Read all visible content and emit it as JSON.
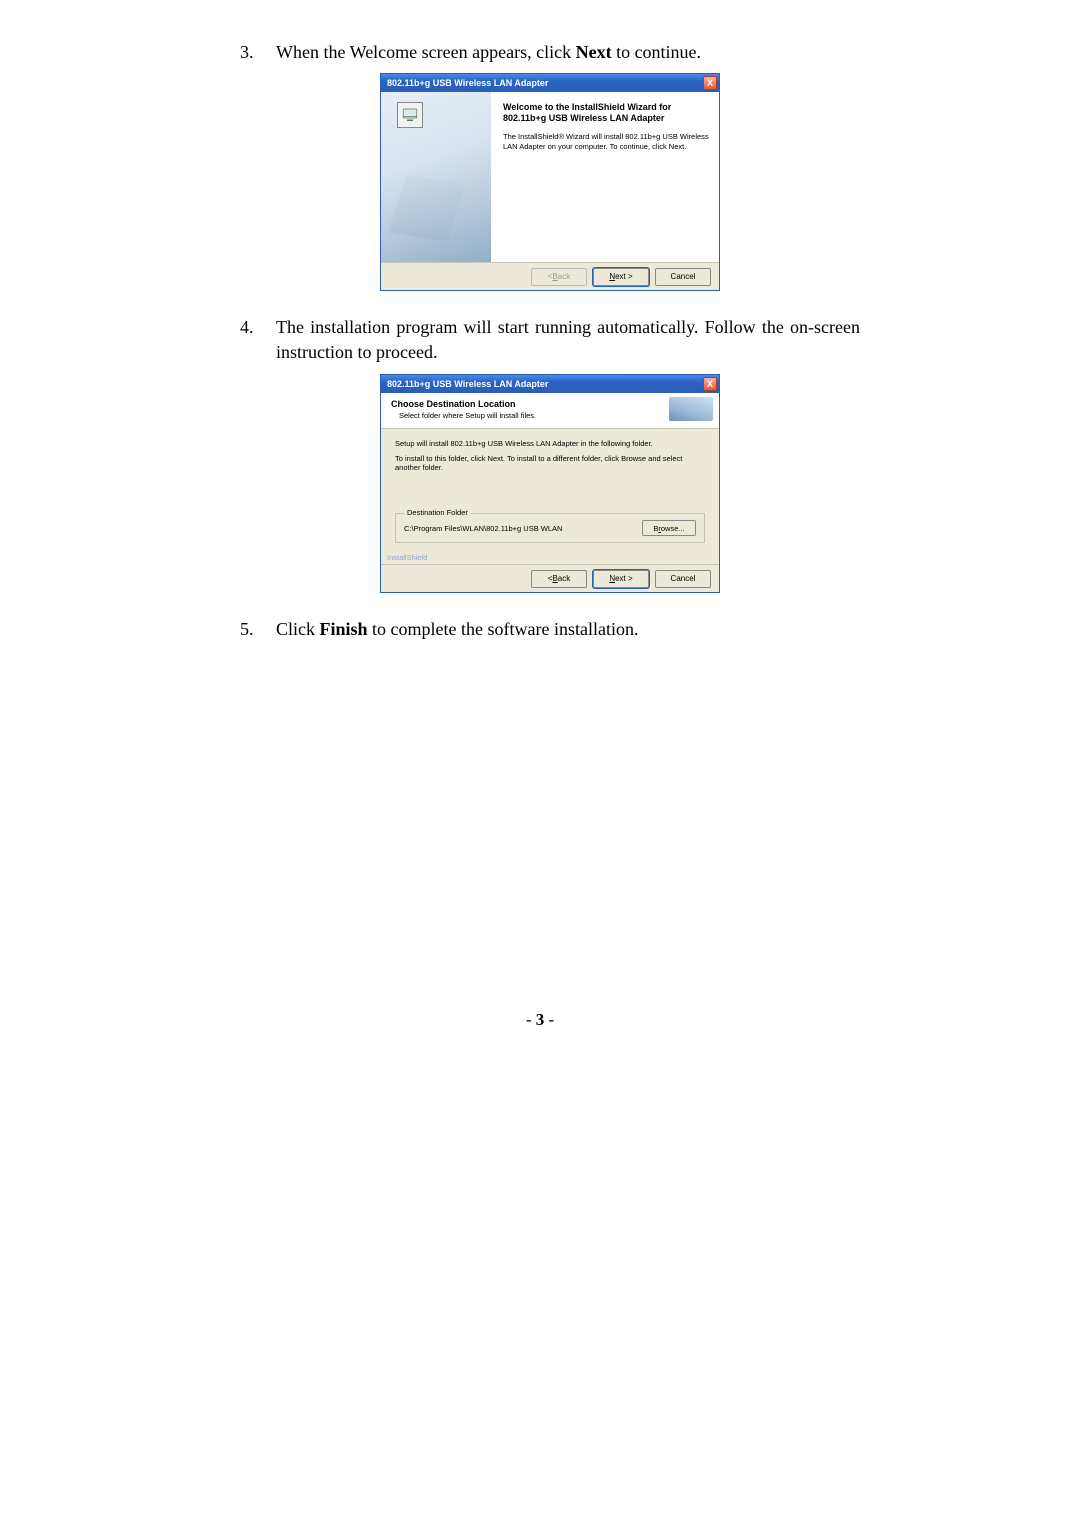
{
  "steps": {
    "s3": {
      "num": "3.",
      "pre": "When the Welcome screen appears, click ",
      "bold": "Next",
      "post": " to continue."
    },
    "s4": {
      "num": "4.",
      "text": "The installation program will start running automatically. Follow the on-screen instruction to proceed."
    },
    "s5": {
      "num": "5.",
      "pre": "Click ",
      "bold": "Finish",
      "post": " to complete the software installation."
    }
  },
  "dialog1": {
    "title": "802.11b+g USB Wireless LAN Adapter",
    "close": "X",
    "heading": "Welcome to the InstallShield Wizard for 802.11b+g USB Wireless LAN Adapter",
    "sub": "The InstallShield® Wizard will install 802.11b+g USB Wireless LAN Adapter on your computer. To continue, click Next.",
    "back_pre": "< ",
    "back_u": "B",
    "back_post": "ack",
    "next_u": "N",
    "next_post": "ext >",
    "cancel": "Cancel"
  },
  "dialog2": {
    "title": "802.11b+g USB Wireless LAN Adapter",
    "close": "X",
    "header_title": "Choose Destination Location",
    "header_sub": "Select folder where Setup will install files.",
    "text1": "Setup will install 802.11b+g USB Wireless LAN Adapter in the following folder.",
    "text2": "To install to this folder, click Next. To install to a different folder, click Browse and select another folder.",
    "fieldset_legend": "Destination Folder",
    "path": "C:\\Program Files\\WLAN\\802.11b+g USB WLAN",
    "browse_pre": "B",
    "browse_u": "r",
    "browse_post": "owse...",
    "brand": "InstallShield",
    "back_pre": "< ",
    "back_u": "B",
    "back_post": "ack",
    "next_u": "N",
    "next_post": "ext >",
    "cancel": "Cancel"
  },
  "page_number": {
    "l": "- ",
    "n": "3",
    "r": " -"
  }
}
